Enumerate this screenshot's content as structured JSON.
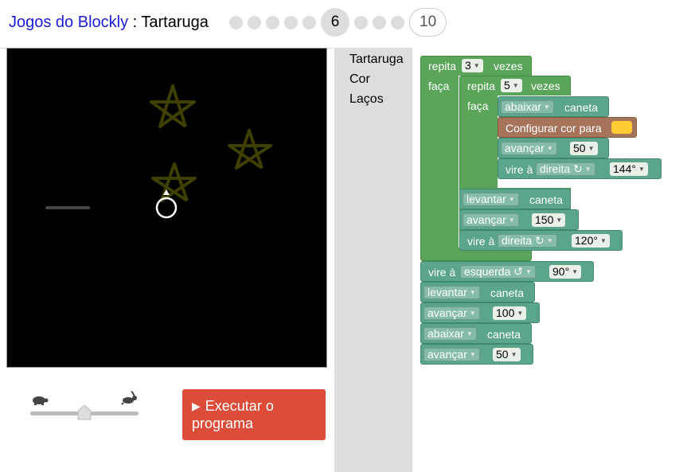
{
  "header": {
    "app_link": "Jogos do Blockly",
    "separator": " : ",
    "game_name": "Tartaruga",
    "current_level": "6",
    "max_level": "10"
  },
  "toolbox": {
    "items": [
      "Tartaruga",
      "Cor",
      "Laços"
    ]
  },
  "controls": {
    "speed_slider_value": 0.5,
    "run_button": "Executar o programa",
    "run_button_line1": "Executar o",
    "run_button_line2": "programa"
  },
  "blocks": {
    "repeat_outer": {
      "label": "repita",
      "count": "3",
      "suffix": "vezes",
      "do": "faça"
    },
    "repeat_inner": {
      "label": "repita",
      "count": "5",
      "suffix": "vezes",
      "do": "faça"
    },
    "pen_down_1": {
      "action": "abaixar",
      "suffix": "caneta"
    },
    "set_color": {
      "label": "Configurar cor para",
      "color": "#ffcc33"
    },
    "move_50a": {
      "action": "avançar",
      "value": "50"
    },
    "turn_144": {
      "label": "vire à",
      "direction": "direita ↻",
      "value": "144°"
    },
    "pen_up_1": {
      "action": "levantar",
      "suffix": "caneta"
    },
    "move_150": {
      "action": "avançar",
      "value": "150"
    },
    "turn_120": {
      "label": "vire à",
      "direction": "direita ↻",
      "value": "120°"
    },
    "turn_90": {
      "label": "vire à",
      "direction": "esquerda ↺",
      "value": "90°"
    },
    "pen_up_2": {
      "action": "levantar",
      "suffix": "caneta"
    },
    "move_100": {
      "action": "avançar",
      "value": "100"
    },
    "pen_down_2": {
      "action": "abaixar",
      "suffix": "caneta"
    },
    "move_50b": {
      "action": "avançar",
      "value": "50"
    }
  },
  "colors": {
    "loop_block": "#5ba55b",
    "turtle_block": "#5ba58c",
    "color_block": "#a5745b",
    "run_button": "#dd4b39",
    "star_stroke": "#3f3f00"
  }
}
